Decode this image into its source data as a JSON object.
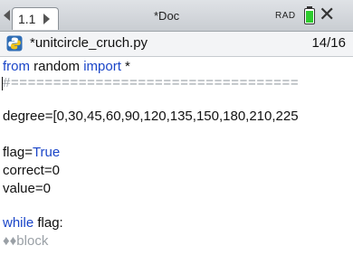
{
  "tabbar": {
    "tab_label": "1.1",
    "doc_title": "*Doc",
    "angle_mode": "RAD"
  },
  "file": {
    "name": "*unitcircle_cruch.py",
    "position": "14/16"
  },
  "code": {
    "line1": {
      "kw1": "from",
      "mid": " random ",
      "kw2": "import",
      "tail": " *"
    },
    "line2": "#==================================",
    "line3": "degree=[0,30,45,60,90,120,135,150,180,210,225",
    "line4": {
      "name": "flag",
      "eq": "=",
      "val": "True"
    },
    "line5": "correct=0",
    "line6": "value=0",
    "line7": {
      "kw": "while",
      "tail": " flag:"
    },
    "line8": "♦♦block"
  },
  "colors": {
    "keyword": "#1a45c8",
    "comment": "#9aa0a6",
    "battery": "#2ecc2e"
  },
  "icons": {
    "left_arrow": "triangle-left",
    "right_arrow": "triangle-right",
    "battery": "battery-icon",
    "close": "close-icon",
    "python": "python-file-icon"
  }
}
